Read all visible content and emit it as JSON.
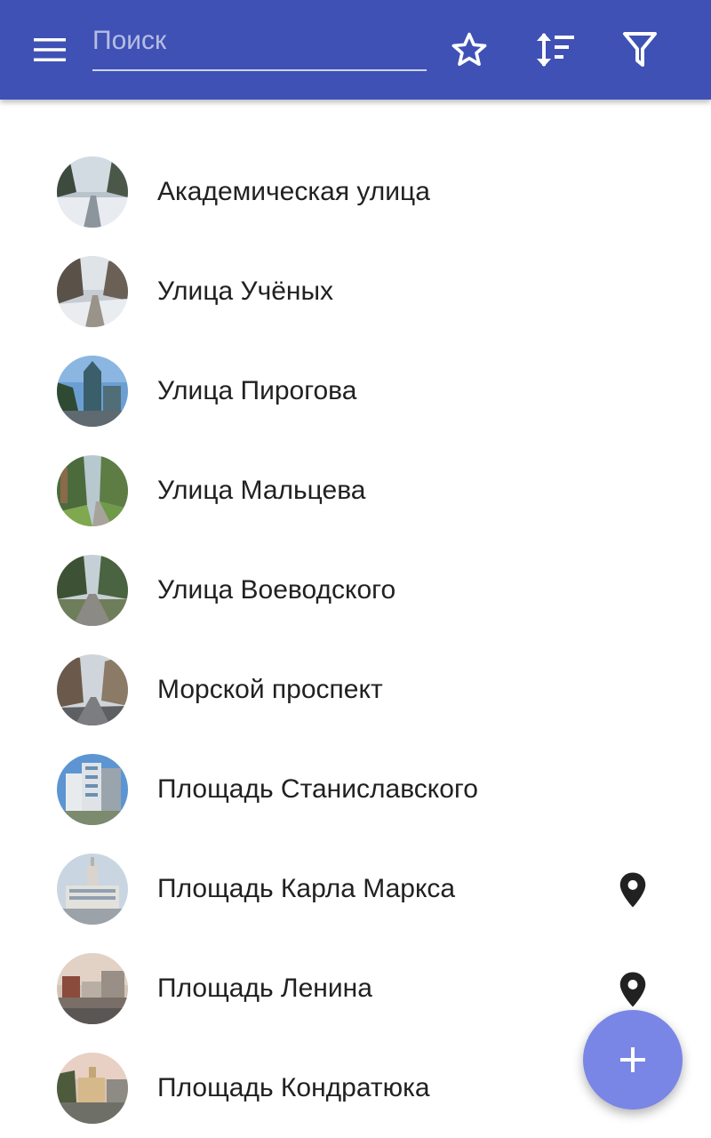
{
  "toolbar": {
    "menu_icon": "menu-icon",
    "search": {
      "placeholder": "Поиск",
      "value": ""
    },
    "actions": [
      {
        "name": "favorites",
        "icon": "star-outline-icon"
      },
      {
        "name": "sort",
        "icon": "sort-icon"
      },
      {
        "name": "filter",
        "icon": "filter-icon"
      }
    ]
  },
  "colors": {
    "appbar": "#3f51b5",
    "fab": "#7986e6",
    "text": "#212121",
    "pin": "#212121"
  },
  "list": {
    "items": [
      {
        "label": "Академическая улица",
        "thumbnail": "street-photo",
        "has_location": false
      },
      {
        "label": "Улица Учёных",
        "thumbnail": "street-photo",
        "has_location": false
      },
      {
        "label": "Улица Пирогова",
        "thumbnail": "building-photo",
        "has_location": false
      },
      {
        "label": "Улица Мальцева",
        "thumbnail": "street-photo",
        "has_location": false
      },
      {
        "label": "Улица Воеводского",
        "thumbnail": "street-photo",
        "has_location": false
      },
      {
        "label": "Морской проспект",
        "thumbnail": "street-photo",
        "has_location": false
      },
      {
        "label": "Площадь Станиславского",
        "thumbnail": "building-photo",
        "has_location": false
      },
      {
        "label": "Площадь Карла Маркса",
        "thumbnail": "square-photo",
        "has_location": true
      },
      {
        "label": "Площадь Ленина",
        "thumbnail": "square-photo",
        "has_location": true
      },
      {
        "label": "Площадь Кондратюка",
        "thumbnail": "square-photo",
        "has_location": false
      }
    ]
  },
  "fab": {
    "icon": "plus-icon"
  }
}
